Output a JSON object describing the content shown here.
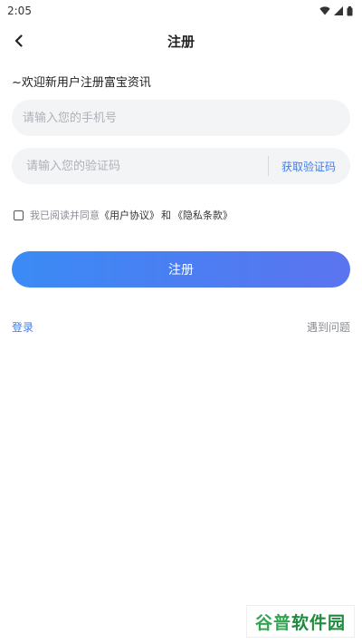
{
  "status_bar": {
    "time": "2:05"
  },
  "header": {
    "title": "注册"
  },
  "welcome_text": "~欢迎新用户注册富宝资讯",
  "phone": {
    "placeholder": "请输入您的手机号",
    "value": ""
  },
  "code": {
    "placeholder": "请输入您的验证码",
    "value": "",
    "get_code_label": "获取验证码"
  },
  "agreement": {
    "prefix": "我已阅读并同意",
    "user_agreement": "《用户协议》",
    "and": "和",
    "privacy_policy": "《隐私条款》",
    "checked": false
  },
  "submit_label": "注册",
  "login_link": "登录",
  "problem_link": "遇到问题",
  "watermark": {
    "part1": "谷普",
    "part2": "软件园"
  },
  "colors": {
    "accent": "#3f7cf0",
    "button_start": "#3a8bf5",
    "button_end": "#5b74ef",
    "field_bg": "#f3f4f6"
  }
}
